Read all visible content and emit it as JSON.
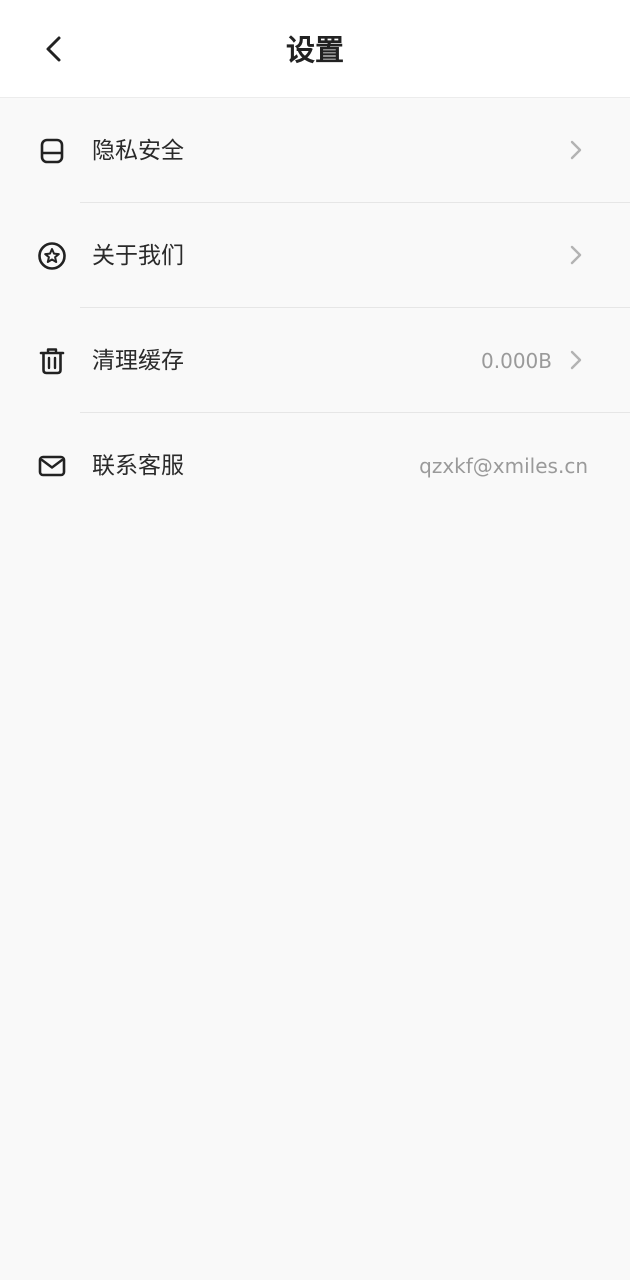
{
  "header": {
    "title": "设置",
    "back_icon": "chevron-left-icon"
  },
  "settings": [
    {
      "id": "privacy",
      "label": "隐私安全",
      "icon": "inbox-tray-icon",
      "value": "",
      "has_chevron": true
    },
    {
      "id": "about",
      "label": "关于我们",
      "icon": "star-circle-icon",
      "value": "",
      "has_chevron": true
    },
    {
      "id": "cache",
      "label": "清理缓存",
      "icon": "trash-icon",
      "value": "0.000B",
      "has_chevron": true
    },
    {
      "id": "contact",
      "label": "联系客服",
      "icon": "mail-icon",
      "value": "qzxkf@xmiles.cn",
      "has_chevron": false
    }
  ],
  "colors": {
    "background": "#f9f9f9",
    "header_bg": "#ffffff",
    "text": "#2a2a2a",
    "secondary_text": "#9a9a9a",
    "chevron": "#b3b3b3"
  }
}
